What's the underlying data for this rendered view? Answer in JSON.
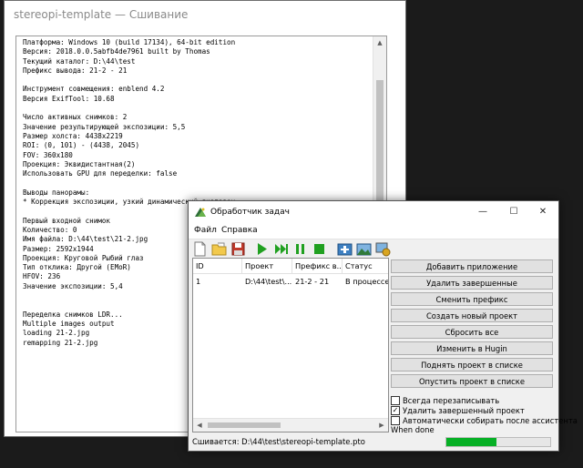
{
  "back_window": {
    "title": "stereopi-template — Сшивание",
    "log_lines": [
      "Платформа: Windows 10 (build 17134), 64-bit edition",
      "Версия: 2018.0.0.5abfb4de7961 built by Thomas",
      "Текущий каталог: D:\\44\\test",
      "Префикс вывода: 21-2 - 21",
      "",
      "Инструмент совмещения: enblend 4.2",
      "Версия ExifTool: 10.68",
      "",
      "Число активных снимков: 2",
      "Значение результирующей экспозиции: 5,5",
      "Размер холста: 4438x2219",
      "ROI: (0, 101) - (4438, 2045)",
      "FOV: 360x180",
      "Проекция: Эквидистантная(2)",
      "Использовать GPU для переделки: false",
      "",
      "Выводы панорамы:",
      "* Коррекция экспозиции, узкий динамический диапазон",
      "",
      "Первый входной снимок",
      "Количество: 0",
      "Имя файла: D:\\44\\test\\21-2.jpg",
      "Размер: 2592x1944",
      "Проекция: Круговой Рыбий глаз",
      "Тип отклика: Другой (EMoR)",
      "HFOV: 236",
      "Значение экспозиции: 5,4",
      "",
      "",
      "Переделка снимков LDR...",
      "Multiple images output",
      "loading 21-2.jpg",
      "remapping 21-2.jpg"
    ]
  },
  "task_window": {
    "title": "Обработчик задач",
    "window_buttons": {
      "minimize": "—",
      "maximize": "☐",
      "close": "✕"
    },
    "menu": [
      "Файл",
      "Справка"
    ],
    "toolbar_icons": [
      "new-file-icon",
      "open-folder-icon",
      "save-icon",
      "play-icon",
      "skip-forward-icon",
      "stop-icon",
      "add-panorama-icon",
      "panorama-icon",
      "settings-image-icon"
    ],
    "columns": [
      "ID",
      "Проект",
      "Префикс в...",
      "Статус"
    ],
    "rows": [
      {
        "id": "1",
        "project": "D:\\44\\test\\...",
        "prefix": "21-2 - 21",
        "status": "В процессе"
      }
    ],
    "buttons": [
      "Добавить приложение",
      "Удалить завершенные",
      "Сменить префикс",
      "Создать новый проект",
      "Сбросить все",
      "Изменить в Hugin",
      "Поднять проект в списке",
      "Опустить проект в списке"
    ],
    "checkboxes": [
      {
        "label": "Всегда перезаписывать",
        "checked": false
      },
      {
        "label": "Удалить завершенный проект",
        "checked": true
      },
      {
        "label": "Автоматически собирать после ассистента",
        "checked": false
      },
      {
        "label": "When done",
        "checked": false
      }
    ],
    "status_text": "Сшивается: D:\\44\\test\\stereopi-template.pto",
    "progress_fraction": 0.48,
    "accent_color": "#06b025"
  }
}
